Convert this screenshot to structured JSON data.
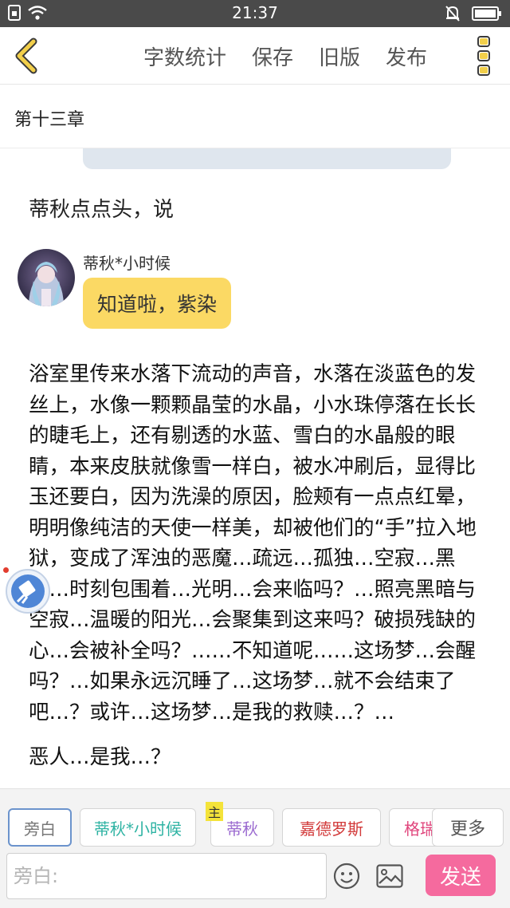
{
  "status_bar": {
    "time": "21:37"
  },
  "toolbar": {
    "items": [
      "字数统计",
      "保存",
      "旧版",
      "发布"
    ]
  },
  "chapter": {
    "title": "第十三章"
  },
  "story": {
    "narration_1": "蒂秋点点头，说",
    "dialogue": {
      "speaker": "蒂秋*小时候",
      "text": "知道啦，紫染"
    },
    "paragraph": "浴室里传来水落下流动的声音，水落在淡蓝色的发丝上，水像一颗颗晶莹的水晶，小水珠停落在长长的睫毛上，还有剔透的水蓝、雪白的水晶般的眼睛，本来皮肤就像雪一样白，被水冲刷后，显得比玉还要白，因为洗澡的原因，脸颊有一点点红晕，明明像纯洁的天使一样美，却被他们的“手”拉入地狱，变成了浑浊的恶魔…疏远…孤独…空寂…黑暗…时刻包围着…光明…会来临吗？…照亮黑暗与空寂…温暖的阳光…会聚集到这来吗？破损残缺的心…会被补全吗？……不知道呢……这场梦…会醒吗？…如果永远沉睡了…这场梦…就不会结束了吧…？或许…这场梦…是我的救赎…？…",
    "narration_2": "恶人…是我…？"
  },
  "roles": [
    {
      "label": "旁白",
      "color": "#777777"
    },
    {
      "label": "蒂秋*小时候",
      "color": "#2eb3a3"
    },
    {
      "label": "蒂秋",
      "color": "#9b6ad0"
    },
    {
      "label": "嘉德罗斯",
      "color": "#d23a3a"
    },
    {
      "label": "格瑞",
      "color": "#e0457c"
    }
  ],
  "main_tag": "主",
  "more_label": "更多",
  "input": {
    "placeholder": "旁白:",
    "value": ""
  },
  "send_label": "发送",
  "colors": {
    "accent_yellow": "#fbd964",
    "send_pink": "#f56a9e",
    "selected_border": "#6b93cc"
  }
}
